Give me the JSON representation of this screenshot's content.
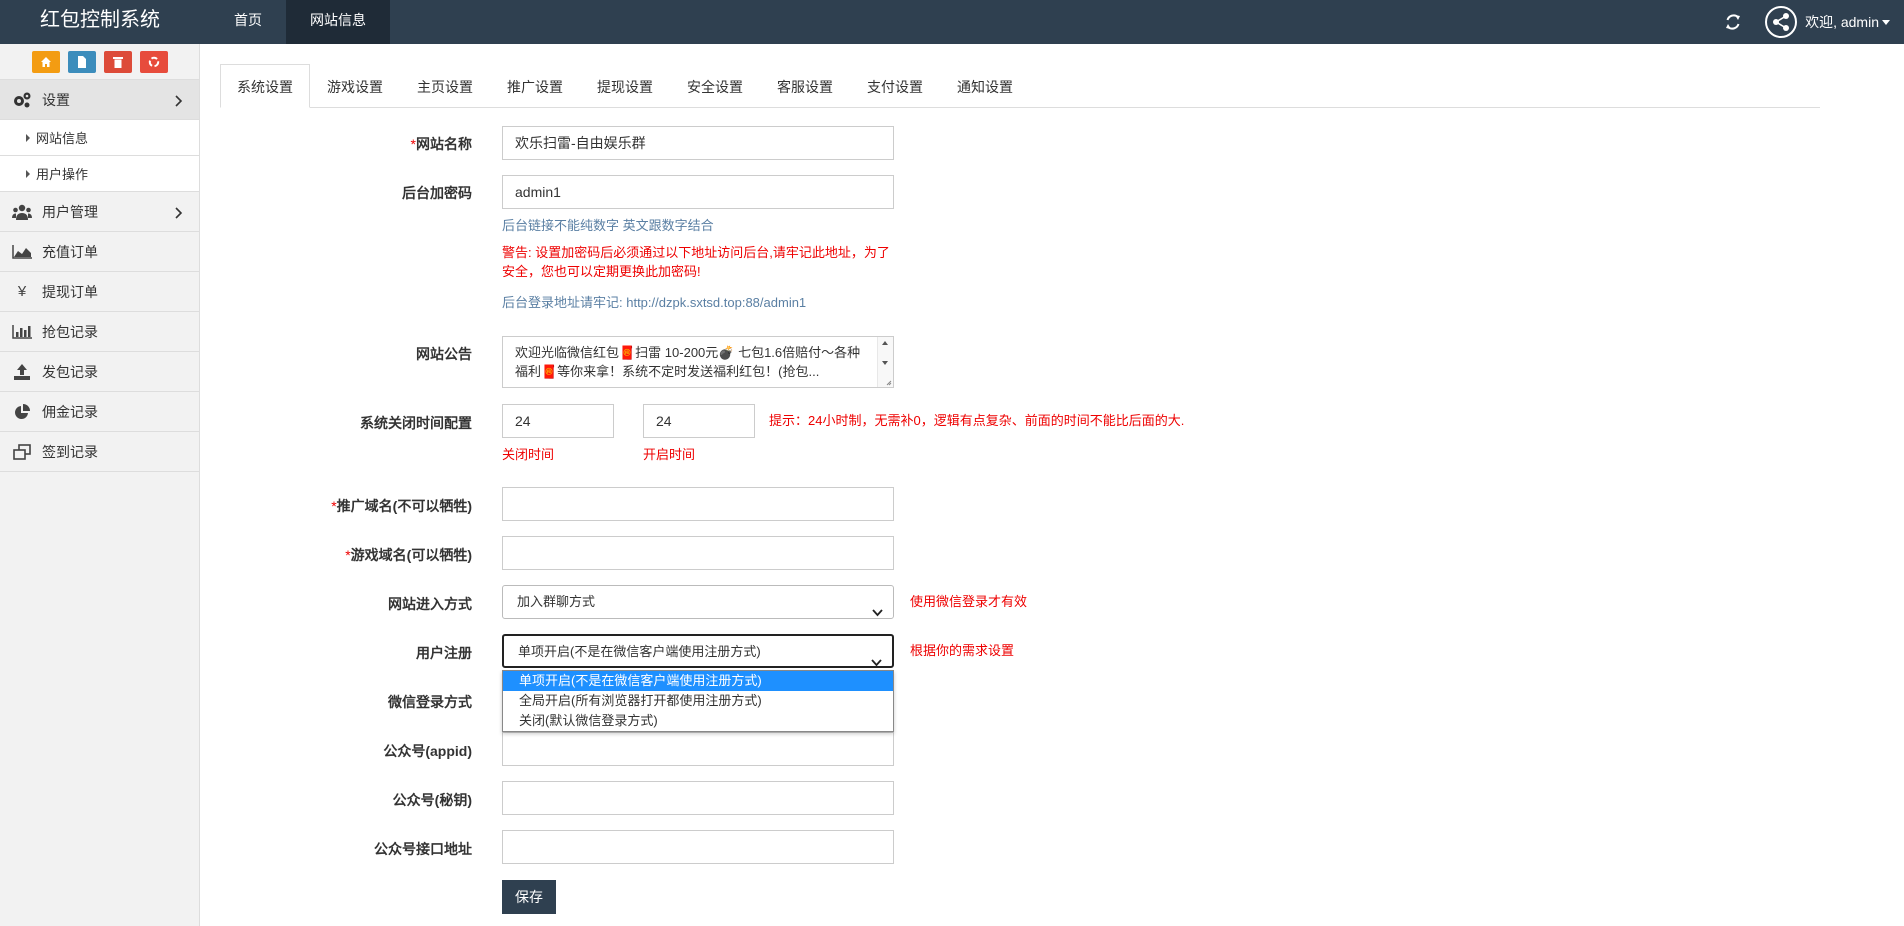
{
  "app": {
    "title": "红包控制系统"
  },
  "topnav": {
    "items": [
      {
        "label": "首页"
      },
      {
        "label": "网站信息"
      }
    ]
  },
  "user": {
    "welcome": "欢迎, admin"
  },
  "sidebar": {
    "menu": [
      {
        "label": "设置",
        "icon": "gears-icon"
      },
      {
        "label": "用户管理",
        "icon": "users-icon"
      },
      {
        "label": "充值订单",
        "icon": "area-chart-icon"
      },
      {
        "label": "提现订单",
        "icon": "yen-icon"
      },
      {
        "label": "抢包记录",
        "icon": "bar-chart-icon"
      },
      {
        "label": "发包记录",
        "icon": "upload-icon"
      },
      {
        "label": "佣金记录",
        "icon": "pie-chart-icon"
      },
      {
        "label": "签到记录",
        "icon": "clone-icon"
      }
    ],
    "submenu": [
      {
        "label": "网站信息"
      },
      {
        "label": "用户操作"
      }
    ]
  },
  "tabs": [
    {
      "label": "系统设置"
    },
    {
      "label": "游戏设置"
    },
    {
      "label": "主页设置"
    },
    {
      "label": "推广设置"
    },
    {
      "label": "提现设置"
    },
    {
      "label": "安全设置"
    },
    {
      "label": "客服设置"
    },
    {
      "label": "支付设置"
    },
    {
      "label": "通知设置"
    }
  ],
  "form": {
    "site_name": {
      "label": "网站名称",
      "value": "欢乐扫雷-自由娱乐群"
    },
    "admin_code": {
      "label": "后台加密码",
      "value": "admin1",
      "hint": "后台链接不能纯数字 英文跟数字结合",
      "warning": "警告:  设置加密码后必须通过以下地址访问后台,请牢记此地址，为了安全，您也可以定期更换此加密码!",
      "login_hint": "后台登录地址请牢记:  http://dzpk.sxtsd.top:88/admin1"
    },
    "announcement": {
      "label": "网站公告",
      "value": "欢迎光临微信红包🧧扫雷  10-200元💣 七包1.6倍赔付～各种福利🧧等你来拿！系统不定时发送福利红包！(抢包..."
    },
    "close_time": {
      "label": "系统关闭时间配置",
      "close_value": "24",
      "open_value": "24",
      "close_caption": "关闭时间",
      "open_caption": "开启时间",
      "tip": "提示：24小时制，无需补0，逻辑有点复杂、前面的时间不能比后面的大."
    },
    "promo_domain": {
      "label": "推广域名(不可以牺牲)"
    },
    "game_domain": {
      "label": "游戏域名(可以牺牲)"
    },
    "entry_mode": {
      "label": "网站进入方式",
      "value": "加入群聊方式",
      "hint": "使用微信登录才有效"
    },
    "registration": {
      "label": "用户注册",
      "value": "单项开启(不是在微信客户端使用注册方式)",
      "hint": "根据你的需求设置",
      "options": [
        "单项开启(不是在微信客户端使用注册方式)",
        "全局开启(所有浏览器打开都使用注册方式)",
        "关闭(默认微信登录方式)"
      ]
    },
    "wechat_login": {
      "label": "微信登录方式"
    },
    "appid": {
      "label": "公众号(appid)"
    },
    "secret": {
      "label": "公众号(秘钥)"
    },
    "api_url": {
      "label": "公众号接口地址"
    },
    "save_label": "保存"
  },
  "colors": {
    "topbar": "#2f4050",
    "accent_red": "#e00000",
    "hint_blue": "#5a7fa3",
    "dropdown_selected": "#1e90ff"
  }
}
